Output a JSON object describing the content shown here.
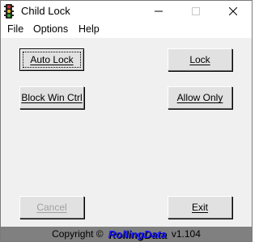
{
  "window": {
    "title": "Child Lock",
    "app_icon": "traffic-light-icon",
    "controls": [
      "minimize-icon",
      "maximize-icon",
      "close-icon"
    ]
  },
  "menu": {
    "file": "File",
    "options": "Options",
    "help": "Help"
  },
  "buttons": {
    "auto_lock": "Auto Lock",
    "block_win_ctrl": "Block Win Ctrl",
    "lock": "Lock",
    "allow_only": "Allow Only",
    "cancel": "Cancel",
    "exit": "Exit"
  },
  "status": {
    "copyright": "Copyright ©",
    "brand": "RollingData",
    "version": "v1.104"
  },
  "colors": {
    "brand": "#1a1aff",
    "statusbar": "#808080",
    "disabled_text": "#a0a0a0"
  }
}
